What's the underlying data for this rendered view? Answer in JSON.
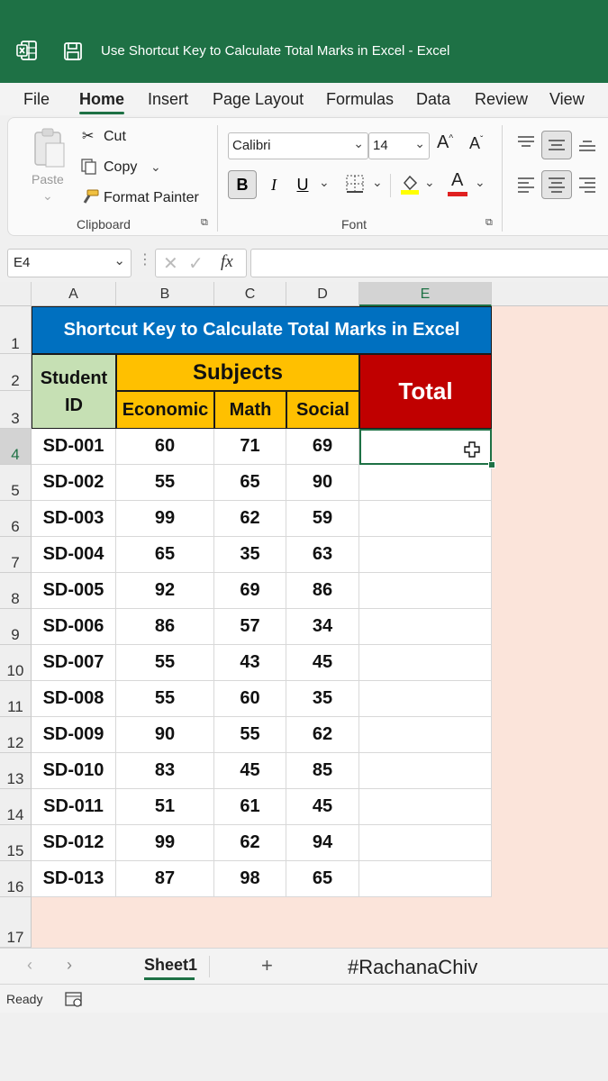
{
  "window": {
    "title": "Use Shortcut Key to Calculate Total Marks in Excel  -  Excel",
    "accent": "#1e7145"
  },
  "menu": [
    "File",
    "Home",
    "Insert",
    "Page Layout",
    "Formulas",
    "Data",
    "Review",
    "View"
  ],
  "ribbon": {
    "clipboard": {
      "paste": "Paste",
      "cut": "Cut",
      "copy": "Copy",
      "format_painter": "Format Painter",
      "group": "Clipboard"
    },
    "font": {
      "name": "Calibri",
      "size": "14",
      "bold": "B",
      "italic": "I",
      "underline": "U",
      "font_color": "A",
      "group": "Font"
    }
  },
  "formula_bar": {
    "name_box": "E4",
    "fx": "fx",
    "formula": ""
  },
  "sheet": {
    "columns": [
      "A",
      "B",
      "C",
      "D",
      "E"
    ],
    "rows": [
      "1",
      "2",
      "3",
      "4",
      "5",
      "6",
      "7",
      "8",
      "9",
      "10",
      "11",
      "12",
      "13",
      "14",
      "15",
      "16",
      "17"
    ],
    "title": "Shortcut Key to Calculate Total Marks in Excel",
    "header": {
      "student_id": "Student ID",
      "subjects": "Subjects",
      "total": "Total",
      "economic": "Economic",
      "math": "Math",
      "social": "Social"
    },
    "records": [
      {
        "id": "SD-001",
        "economic": "60",
        "math": "71",
        "social": "69"
      },
      {
        "id": "SD-002",
        "economic": "55",
        "math": "65",
        "social": "90"
      },
      {
        "id": "SD-003",
        "economic": "99",
        "math": "62",
        "social": "59"
      },
      {
        "id": "SD-004",
        "economic": "65",
        "math": "35",
        "social": "63"
      },
      {
        "id": "SD-005",
        "economic": "92",
        "math": "69",
        "social": "86"
      },
      {
        "id": "SD-006",
        "economic": "86",
        "math": "57",
        "social": "34"
      },
      {
        "id": "SD-007",
        "economic": "55",
        "math": "43",
        "social": "45"
      },
      {
        "id": "SD-008",
        "economic": "55",
        "math": "60",
        "social": "35"
      },
      {
        "id": "SD-009",
        "economic": "90",
        "math": "55",
        "social": "62"
      },
      {
        "id": "SD-010",
        "economic": "83",
        "math": "45",
        "social": "85"
      },
      {
        "id": "SD-011",
        "economic": "51",
        "math": "61",
        "social": "45"
      },
      {
        "id": "SD-012",
        "economic": "99",
        "math": "62",
        "social": "94"
      },
      {
        "id": "SD-013",
        "economic": "87",
        "math": "98",
        "social": "65"
      }
    ],
    "colors": {
      "title_bg": "#0070c0",
      "id_bg": "#c6e0b4",
      "subjects_bg": "#ffc000",
      "total_bg": "#c00000",
      "sheet_bg": "#fbe4da"
    }
  },
  "tabs": {
    "active": "Sheet1",
    "add": "+",
    "hashtag": "#RachanaChiv"
  },
  "status": {
    "text": "Ready"
  }
}
